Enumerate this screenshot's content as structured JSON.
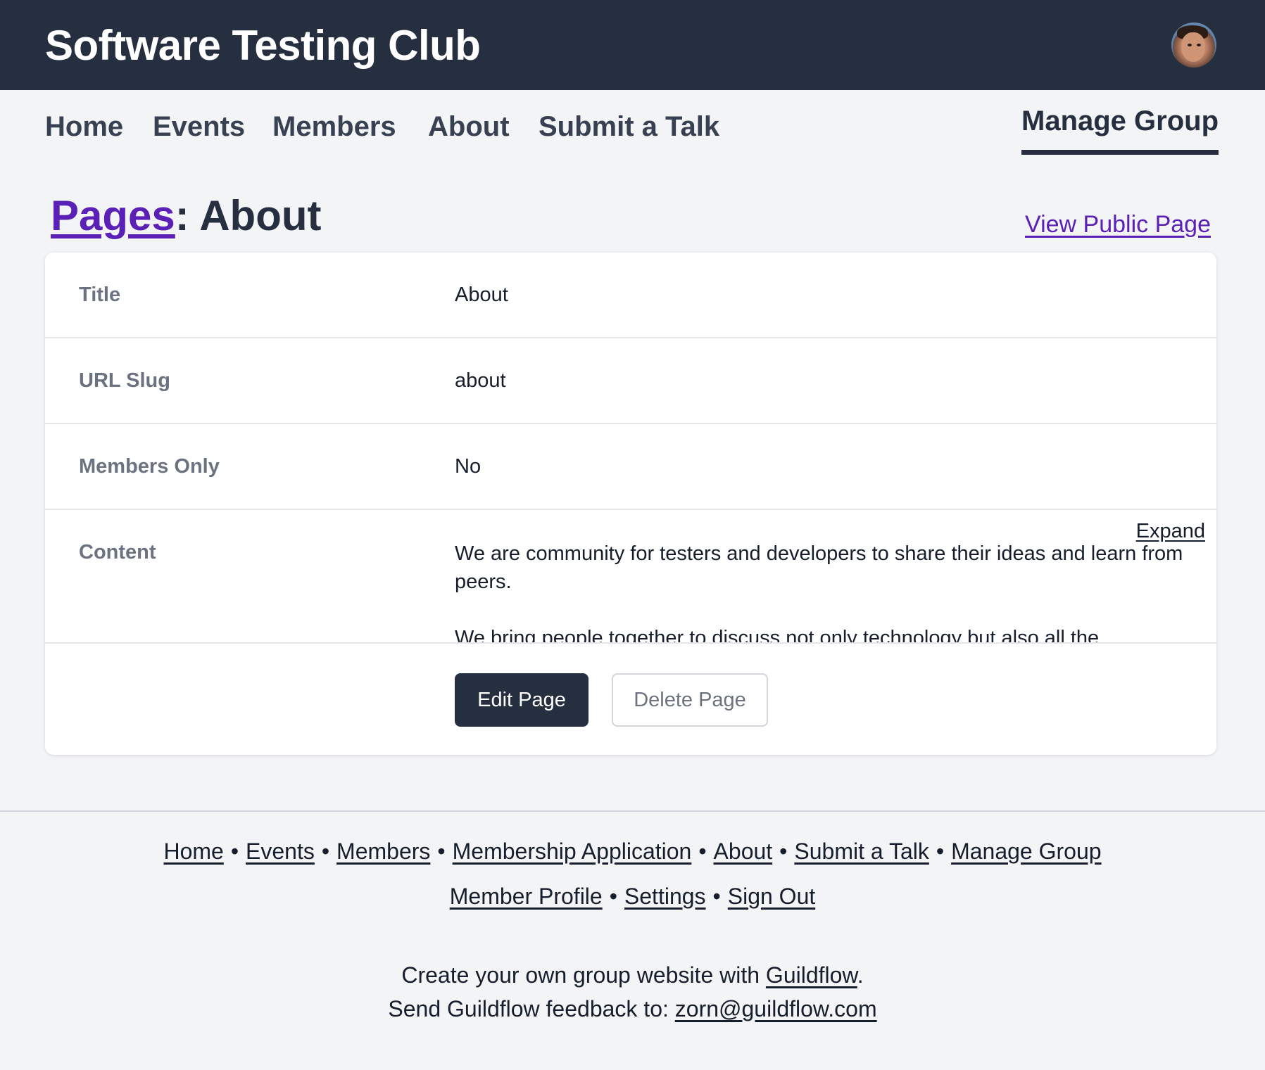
{
  "header": {
    "site_title": "Software Testing Club",
    "avatar_icon": "user-avatar"
  },
  "nav": {
    "items": [
      {
        "label": "Home"
      },
      {
        "label": "Events"
      },
      {
        "label": "Members"
      },
      {
        "label": "About"
      },
      {
        "label": "Submit a Talk"
      }
    ],
    "manage_label": "Manage Group"
  },
  "page": {
    "breadcrumb_link": "Pages",
    "separator": ": ",
    "title": "About",
    "view_public_label": "View Public Page"
  },
  "details": {
    "rows": [
      {
        "label": "Title",
        "value": "About"
      },
      {
        "label": "URL Slug",
        "value": "about"
      },
      {
        "label": "Members Only",
        "value": "No"
      }
    ],
    "content_label": "Content",
    "expand_label": "Expand",
    "content_paragraphs": [
      "We are community for testers and developers to share their ideas and learn from peers.",
      "We bring people together to discuss not only technology but also all the"
    ]
  },
  "actions": {
    "edit_label": "Edit Page",
    "delete_label": "Delete Page"
  },
  "footer": {
    "links_row1": [
      "Home",
      "Events",
      "Members",
      "Membership Application",
      "About",
      "Submit a Talk",
      "Manage Group"
    ],
    "links_row2": [
      "Member Profile",
      "Settings",
      "Sign Out"
    ],
    "separator": "•",
    "promo_prefix": "Create your own group website with ",
    "promo_link": "Guildflow",
    "promo_suffix": ".",
    "feedback_prefix": "Send Guildflow feedback to: ",
    "feedback_email": "zorn@guildflow.com"
  },
  "colors": {
    "header_bg": "#252f3f",
    "page_bg": "#f3f4f6",
    "link_purple": "#5b21b6",
    "card_bg": "#ffffff"
  }
}
